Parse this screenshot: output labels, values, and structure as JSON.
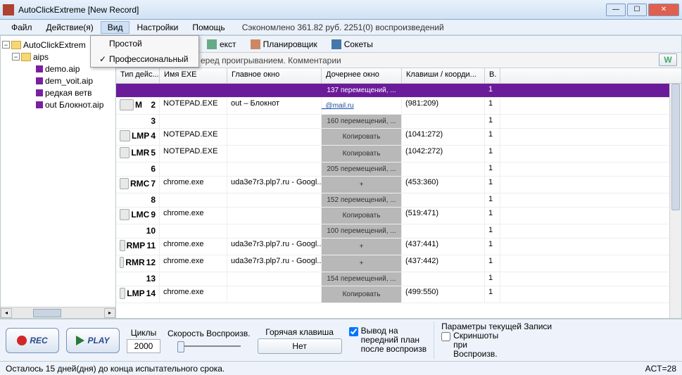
{
  "window": {
    "title": "AutoClickExtreme [New Record]"
  },
  "menus": {
    "file": "Файл",
    "actions": "Действие(я)",
    "view": "Вид",
    "settings": "Настройки",
    "help": "Помощь",
    "saved": "Сэкономлено 361.82 руб. 2251(0) воспроизведений"
  },
  "viewmenu": {
    "simple": "Простой",
    "pro": "Профессиональный"
  },
  "tree": {
    "root": "AutoClickExtrem",
    "folder": "aips",
    "files": [
      "demo.aip",
      "dem_voit.aip",
      "редкая ветв",
      "out  Блокнот.aip"
    ]
  },
  "toolbar": {
    "text": "екст",
    "scheduler": "Планировщик",
    "sockets": "Сокеты"
  },
  "subbar": {
    "text": "еред проигрыванием. Комментарии",
    "go": "W"
  },
  "headers": {
    "type": "Тип дейс...",
    "exe": "Имя EXE",
    "mainwin": "Главное окно",
    "childwin": "Дочернее окно",
    "keys": "Клавиши / коорди...",
    "v": "В."
  },
  "rows": [
    {
      "n": "",
      "type": "",
      "exe": "",
      "main": "",
      "child": "137 перемещений, ...",
      "keys": "",
      "v": "1",
      "sel": true
    },
    {
      "n": "2",
      "type": "M",
      "exe": "NOTEPAD.EXE",
      "main": "out – Блокнот",
      "child": "_@mail.ru",
      "keys": "(981:209)",
      "v": "1",
      "link": true
    },
    {
      "n": "3",
      "type": "",
      "exe": "",
      "main": "",
      "child": "160 перемещений, ...",
      "keys": "",
      "v": "1"
    },
    {
      "n": "4",
      "type": "LMP",
      "exe": "NOTEPAD.EXE",
      "main": "",
      "child": "Копировать",
      "keys": "(1041:272)",
      "v": "1",
      "btn": true
    },
    {
      "n": "5",
      "type": "LMR",
      "exe": "NOTEPAD.EXE",
      "main": "",
      "child": "Копировать",
      "keys": "(1042:272)",
      "v": "1",
      "btn": true
    },
    {
      "n": "6",
      "type": "",
      "exe": "",
      "main": "",
      "child": "205 перемещений, ...",
      "keys": "",
      "v": "1"
    },
    {
      "n": "7",
      "type": "RMC",
      "exe": "chrome.exe",
      "main": "uda3e7r3.plp7.ru - Googl...",
      "child": "+",
      "keys": "(453:360)",
      "v": "1",
      "btn": true
    },
    {
      "n": "8",
      "type": "",
      "exe": "",
      "main": "",
      "child": "152 перемещений, ...",
      "keys": "",
      "v": "1"
    },
    {
      "n": "9",
      "type": "LMC",
      "exe": "chrome.exe",
      "main": "",
      "child": "Копировать",
      "keys": "(519:471)",
      "v": "1",
      "btn": true
    },
    {
      "n": "10",
      "type": "",
      "exe": "",
      "main": "",
      "child": "100 перемещений, ...",
      "keys": "",
      "v": "1"
    },
    {
      "n": "11",
      "type": "RMP",
      "exe": "chrome.exe",
      "main": "uda3e7r3.plp7.ru - Googl...",
      "child": "+",
      "keys": "(437:441)",
      "v": "1",
      "btn": true
    },
    {
      "n": "12",
      "type": "RMR",
      "exe": "chrome.exe",
      "main": "uda3e7r3.plp7.ru - Googl...",
      "child": "+",
      "keys": "(437:442)",
      "v": "1",
      "btn": true
    },
    {
      "n": "13",
      "type": "",
      "exe": "",
      "main": "",
      "child": "154 перемещений, ...",
      "keys": "",
      "v": "1"
    },
    {
      "n": "14",
      "type": "LMP",
      "exe": "chrome.exe",
      "main": "",
      "child": "Копировать",
      "keys": "(499:550)",
      "v": "1",
      "btn": true
    }
  ],
  "bottom": {
    "rec": "REC",
    "play": "PLAY",
    "cycles": "Циклы",
    "cycles_val": "2000",
    "speed": "Скорость Воспроизв.",
    "hotkey": "Горячая клавиша",
    "hotkey_val": "Нет",
    "fg1": "Вывод на",
    "fg2": "передний план",
    "fg3": "после воспроизв",
    "params": "Параметры текущей Записи",
    "ss1": "Скриншоты",
    "ss2": "при",
    "ss3": "Воспроизв."
  },
  "status": {
    "left": "Осталось 15 дней(дня) до конца испытательного срока.",
    "right": "ACT=28"
  }
}
